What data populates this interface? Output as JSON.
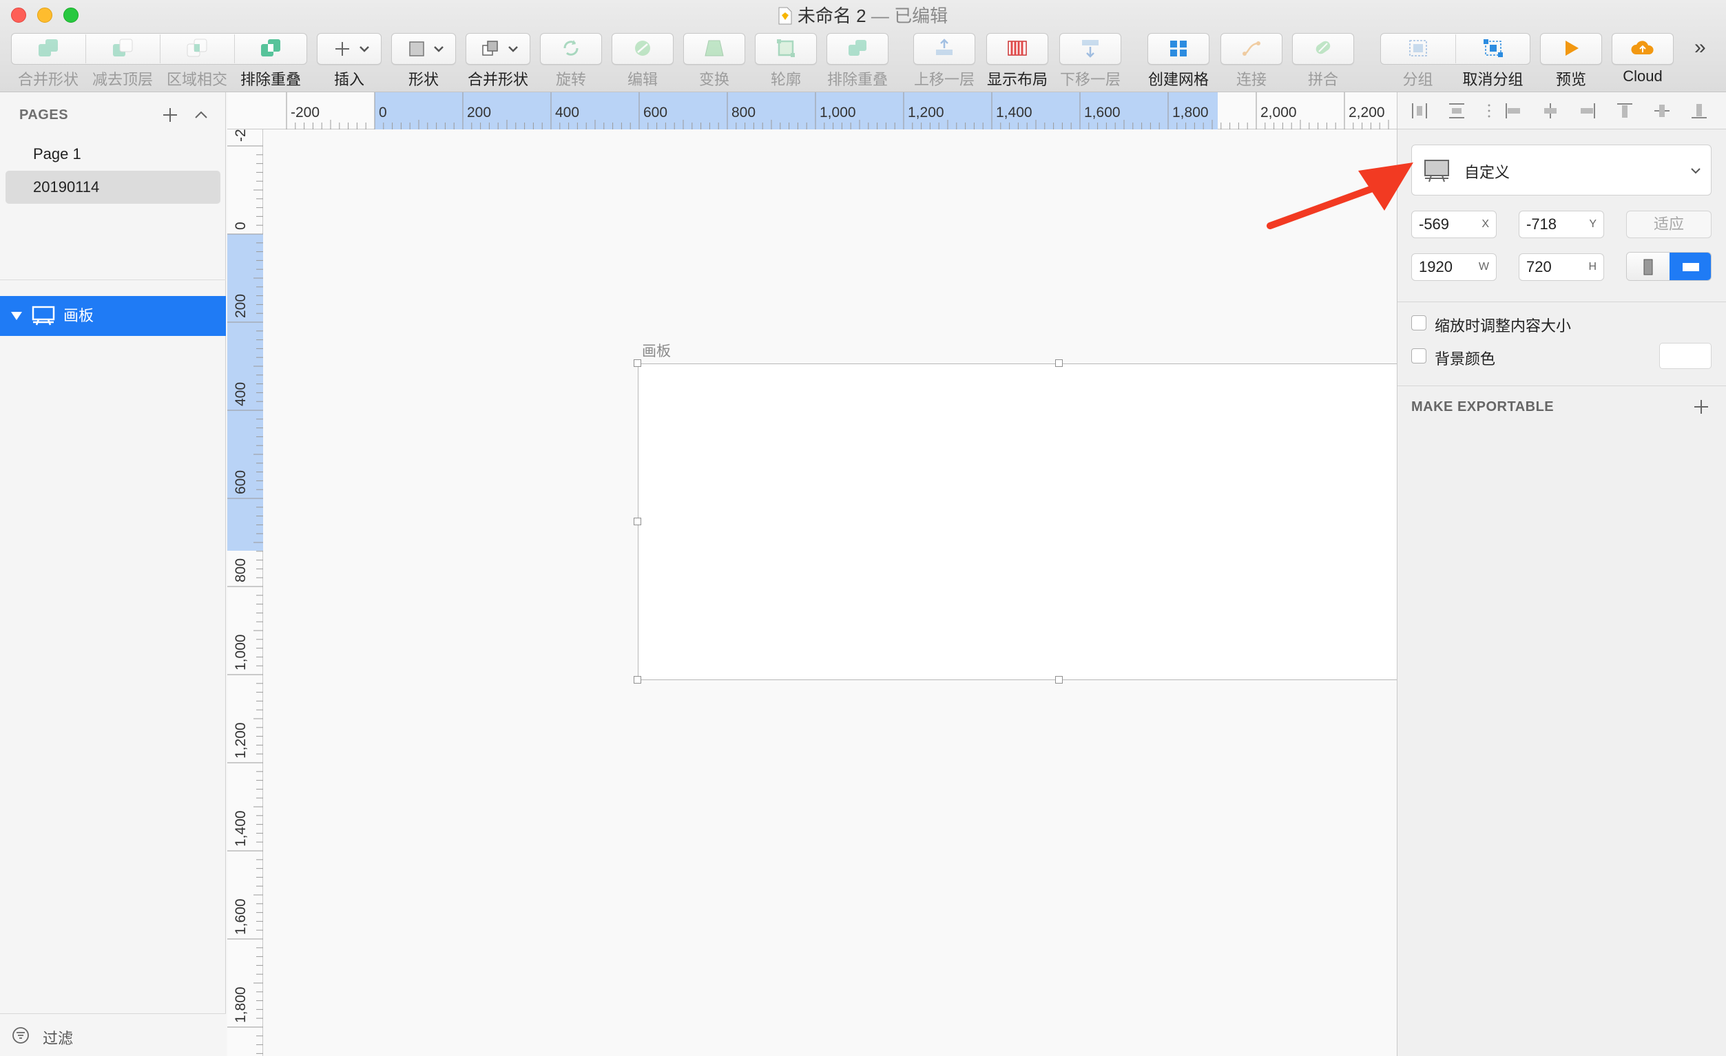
{
  "window": {
    "title": "未命名 2",
    "status": "— 已编辑"
  },
  "toolbar": {
    "union": "合并形状",
    "subtract": "减去顶层",
    "intersect": "区域相交",
    "difference": "排除重叠",
    "insert": "插入",
    "shape": "形状",
    "combine": "合并形状",
    "rotate": "旋转",
    "edit": "编辑",
    "transform": "变换",
    "outline": "轮廓",
    "flatten": "排除重叠",
    "forward": "上移一层",
    "layout": "显示布局",
    "backward": "下移一层",
    "grid": "创建网格",
    "link": "连接",
    "mask": "拼合",
    "group": "分组",
    "ungroup": "取消分组",
    "preview": "预览",
    "cloud": "Cloud",
    "more": "»"
  },
  "pages": {
    "header": "PAGES",
    "items": [
      "Page 1",
      "20190114"
    ],
    "selected": "20190114"
  },
  "layers": {
    "artboard": "画板"
  },
  "filter": {
    "label": "过滤"
  },
  "ruler": {
    "top": [
      "-200",
      "0",
      "200",
      "400",
      "600",
      "800",
      "1,000",
      "1,200",
      "1,400",
      "1,600",
      "1,800",
      "2,000",
      "2,200"
    ],
    "left": [
      "-2",
      "0",
      "200",
      "400",
      "600",
      "800",
      "1,000",
      "1,200",
      "1,400",
      "1,600",
      "1,800"
    ]
  },
  "canvas": {
    "artboard_label": "画板"
  },
  "inspector": {
    "preset": "自定义",
    "x": "-569",
    "x_suffix": "X",
    "y": "-718",
    "y_suffix": "Y",
    "fit": "适应",
    "w": "1920",
    "w_suffix": "W",
    "h": "720",
    "h_suffix": "H",
    "resize_content": "缩放时调整内容大小",
    "bg_color": "背景颜色",
    "export": "MAKE EXPORTABLE"
  },
  "colors": {
    "accent": "#1f7bf5",
    "arrow": "#f23a22",
    "highlight": "#b9d3f6"
  }
}
